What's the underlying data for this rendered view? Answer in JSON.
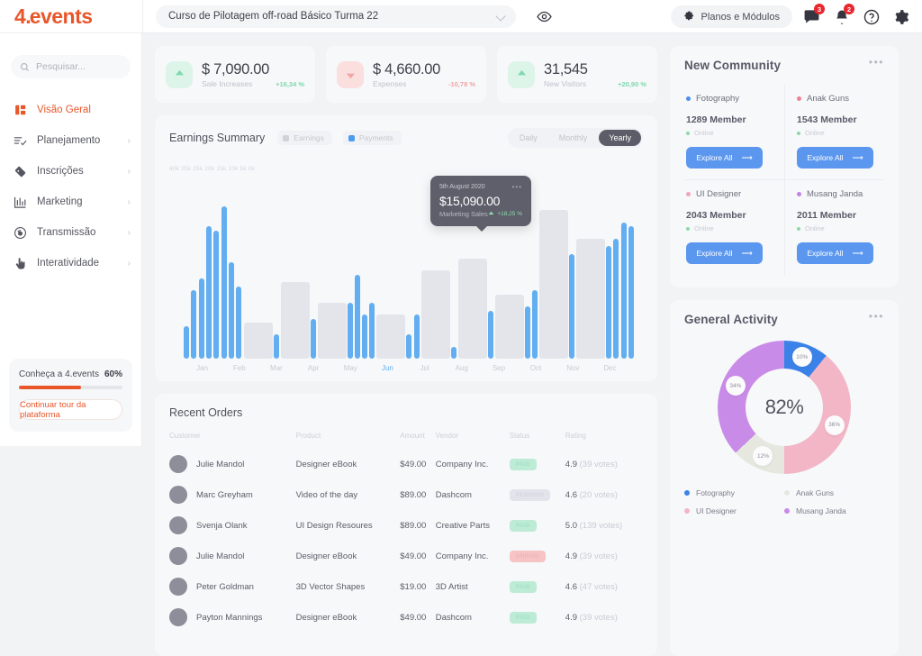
{
  "brand": {
    "name_prefix": "4",
    "name_dot": ".",
    "name_suffix": "events"
  },
  "topbar": {
    "course": "Curso de Pilotagem off-road Básico Turma 22",
    "eye_icon": "eye-icon",
    "chevron_icon": "chevron-down-icon",
    "planos_label": "Planos e Módulos",
    "puzzle_icon": "puzzle-icon",
    "chat_badge": "3",
    "bell_badge": "2"
  },
  "sidebar": {
    "search_placeholder": "Pesquisar...",
    "items": [
      {
        "label": "Visão Geral",
        "icon": "grid-icon",
        "arrow": "",
        "active": true
      },
      {
        "label": "Planejamento",
        "icon": "checklist-icon",
        "arrow": "›",
        "active": false
      },
      {
        "label": "Inscrições",
        "icon": "ticket-icon",
        "arrow": "›",
        "active": false
      },
      {
        "label": "Marketing",
        "icon": "bar-chart-icon",
        "arrow": "›",
        "active": false
      },
      {
        "label": "Transmissão",
        "icon": "broadcast-icon",
        "arrow": "›",
        "active": false
      },
      {
        "label": "Interatividade",
        "icon": "hand-pointer-icon",
        "arrow": "›",
        "active": false
      }
    ],
    "promo": {
      "title": "Conheça a 4.events",
      "percent": "60%",
      "progress": 60,
      "button": "Continuar tour da plataforma"
    }
  },
  "stats": [
    {
      "value": "$ 7,090.00",
      "label": "Sale Increases",
      "delta": "+16,34 %",
      "direction": "up",
      "color": "#7dd9ae",
      "bg": "#ddf4e9"
    },
    {
      "value": "$ 4,660.00",
      "label": "Expenses",
      "delta": "-10,78 %",
      "direction": "down",
      "color": "#f2a5a5",
      "bg": "#fbdede"
    },
    {
      "value": "31,545",
      "label": "New Visitors",
      "delta": "+20,90 %",
      "direction": "up",
      "color": "#7dd9ae",
      "bg": "#ddf4e9"
    }
  ],
  "earnings": {
    "title": "Earnings Summary",
    "legend": [
      {
        "label": "Earnings",
        "color": "#cfd2d9"
      },
      {
        "label": "Payments",
        "color": "#4d9bee"
      }
    ],
    "ranges": [
      {
        "label": "Daily",
        "active": false
      },
      {
        "label": "Monthly",
        "active": false
      },
      {
        "label": "Yearly",
        "active": true
      }
    ],
    "tooltip": {
      "date": "5th August 2020",
      "value": "$15,090.00",
      "label": "Marketing Sales",
      "delta": "+18,25 %",
      "dots": "•••"
    }
  },
  "chart_data": {
    "type": "bar",
    "title": "Earnings Summary",
    "xlabel": "",
    "ylabel": "",
    "ylim": [
      0,
      40000
    ],
    "yticks": [
      "40k",
      "35k",
      "25k",
      "20k",
      "15k",
      "10k",
      "5k",
      "0k"
    ],
    "ytick_string": "40k 35k 25k 20k 15k 10k 5k 0k",
    "categories": [
      "Jan",
      "Feb",
      "Mar",
      "Apr",
      "May",
      "Jun",
      "Jul",
      "Aug",
      "Sep",
      "Oct",
      "Nov",
      "Dec"
    ],
    "highlight_category": "Jun",
    "grid": false,
    "legend_position": "top-left",
    "series": [
      {
        "name": "Payments",
        "color": "#62aef0",
        "values": [
          8,
          17,
          20,
          33,
          32,
          38,
          24,
          18,
          6,
          10,
          14,
          21,
          11,
          14,
          6,
          11,
          3,
          12,
          13,
          17,
          26,
          28,
          30,
          34,
          33
        ]
      },
      {
        "name": "Earnings",
        "color": "#e3e5ea",
        "values": [
          0,
          0,
          0,
          0,
          0,
          0,
          0,
          0,
          9,
          19,
          14,
          0,
          0,
          0,
          11,
          0,
          22,
          25,
          16,
          0,
          37,
          30,
          0,
          0,
          0
        ]
      }
    ]
  },
  "orders": {
    "title": "Recent Orders",
    "columns": [
      "Customer",
      "Product",
      "Amount",
      "Vendor",
      "Status",
      "Rating"
    ],
    "rows": [
      {
        "customer": "Julie Mandol",
        "product": "Designer eBook",
        "amount": "$49.00",
        "vendor": "Company Inc.",
        "status": "PAID",
        "status_kind": "paid",
        "rating": "4.9",
        "votes": "(39 votes)"
      },
      {
        "customer": "Marc Greyham",
        "product": "Video of the day",
        "amount": "$89.00",
        "vendor": "Dashcom",
        "status": "PENDING",
        "status_kind": "pending",
        "rating": "4.6",
        "votes": "(20 votes)"
      },
      {
        "customer": "Svenja Olank",
        "product": "UI Design Resoures",
        "amount": "$89.00",
        "vendor": "Creative Parts",
        "status": "PAID",
        "status_kind": "paid",
        "rating": "5.0",
        "votes": "(139 votes)"
      },
      {
        "customer": "Julie Mandol",
        "product": "Designer eBook",
        "amount": "$49.00",
        "vendor": "Company Inc.",
        "status": "UNPAID",
        "status_kind": "unpaid",
        "rating": "4.9",
        "votes": "(39 votes)"
      },
      {
        "customer": "Peter Goldman",
        "product": "3D Vector Shapes",
        "amount": "$19.00",
        "vendor": "3D Artist",
        "status": "PAID",
        "status_kind": "paid",
        "rating": "4.6",
        "votes": "(47 votes)"
      },
      {
        "customer": "Payton Mannings",
        "product": "Designer eBook",
        "amount": "$49.00",
        "vendor": "Dashcom",
        "status": "PAID",
        "status_kind": "paid",
        "rating": "4.9",
        "votes": "(39 votes)"
      }
    ]
  },
  "community": {
    "title": "New Community",
    "menu_icon": "more-dots-icon",
    "cells": [
      {
        "name": "Fotography",
        "color": "#4d8df0",
        "members": "1289 Member",
        "online": "Online",
        "button": "Explore All"
      },
      {
        "name": "Anak Guns",
        "color": "#ef8097",
        "members": "1543 Member",
        "online": "Online",
        "button": "Explore All"
      },
      {
        "name": "UI Designer",
        "color": "#efa6bd",
        "members": "2043 Member",
        "online": "Online",
        "button": "Explore All"
      },
      {
        "name": "Musang Janda",
        "color": "#c084e8",
        "members": "2011 Member",
        "online": "Online",
        "button": "Explore All"
      }
    ]
  },
  "activity": {
    "title": "General Activity",
    "menu_icon": "more-dots-icon",
    "center": "82%",
    "legend": [
      {
        "label": "Fotography",
        "color": "#3b82e8"
      },
      {
        "label": "Anak Guns",
        "color": "#e6e8e0"
      },
      {
        "label": "UI Designer",
        "color": "#f2b6c6"
      },
      {
        "label": "Musang Janda",
        "color": "#c98be8"
      }
    ],
    "donut_chart": {
      "type": "pie",
      "title": "General Activity",
      "center_label": "82%",
      "labels": [
        "Fotography",
        "UI Designer",
        "Anak Guns",
        "Musang Janda"
      ],
      "values": [
        10,
        36,
        12,
        34
      ],
      "value_labels": [
        "10%",
        "36%",
        "12%",
        "34%"
      ],
      "colors": [
        "#3b82e8",
        "#f2b6c6",
        "#e6e8e0",
        "#c98be8"
      ]
    }
  }
}
